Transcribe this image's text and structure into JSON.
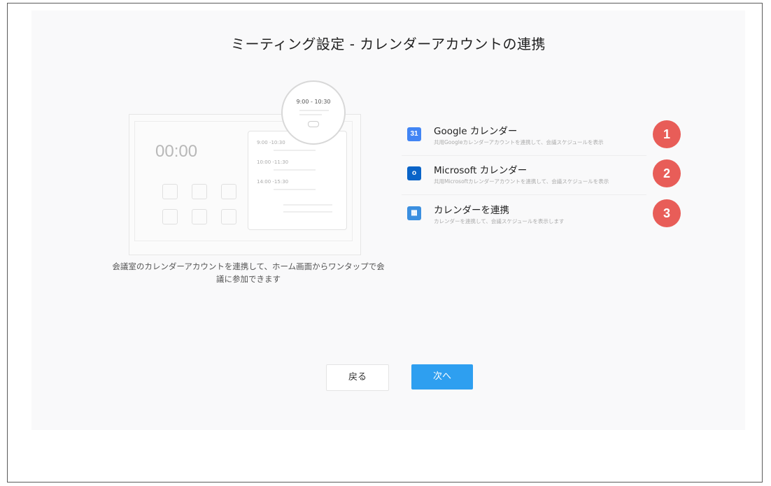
{
  "header": {
    "title": "ミーティング設定 - カレンダーアカウントの連携"
  },
  "illustration": {
    "clock": "00:00",
    "bubble_time": "9:00 - 10:30",
    "schedule_rows": [
      "9:00 -10:30",
      "10:00 -11:30",
      "14:00 -15:30"
    ]
  },
  "caption": "会議室のカレンダーアカウントを連携して、ホーム画面からワンタップで会議に参加できます",
  "options": [
    {
      "name": "Google カレンダー",
      "desc": "共用Googleカレンダーアカウントを連携して、会議スケジュールを表示",
      "icon": "google-calendar-icon",
      "color": "#4285f4",
      "glyph": "31",
      "badge": "1"
    },
    {
      "name": "Microsoft カレンダー",
      "desc": "共用Microsoftカレンダーアカウントを連携して、会議スケジュールを表示",
      "icon": "outlook-icon",
      "color": "#0a64c8",
      "glyph": "o",
      "badge": "2"
    },
    {
      "name": "カレンダーを連携",
      "desc": "カレンダーを連携して、会議スケジュールを表示します",
      "icon": "calendar-link-icon",
      "color": "#3b8fe0",
      "glyph": "▦",
      "badge": "3"
    }
  ],
  "buttons": {
    "back": "戻る",
    "next": "次へ"
  },
  "colors": {
    "accent": "#2e9ff0",
    "badge": "#e85d58"
  }
}
